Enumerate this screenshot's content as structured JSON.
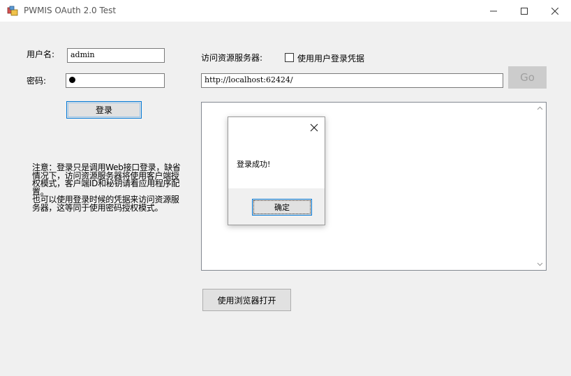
{
  "window": {
    "title": "PWMIS OAuth 2.0 Test",
    "accent": "#0078d7"
  },
  "login": {
    "username_label": "用户名:",
    "username_value": "admin",
    "password_label": "密码:",
    "login_button": "登录"
  },
  "resource": {
    "label": "访问资源服务器:",
    "checkbox_label": "使用用户登录凭据",
    "checkbox_checked": false,
    "url_value": "http://localhost:62424/",
    "go_button": "Go",
    "browser_button": "使用浏览器打开"
  },
  "note": {
    "line1": "注意：登录只是调用Web接口登录，缺省情况下，访问资源服务器将使用客户端授权模式，客户端ID和秘钥请看应用程序配置。",
    "line2": "也可以使用登录时候的凭据来访问资源服务器，这等同于使用密码授权模式。"
  },
  "dialog": {
    "message": "登录成功!",
    "ok_button": "确定"
  }
}
